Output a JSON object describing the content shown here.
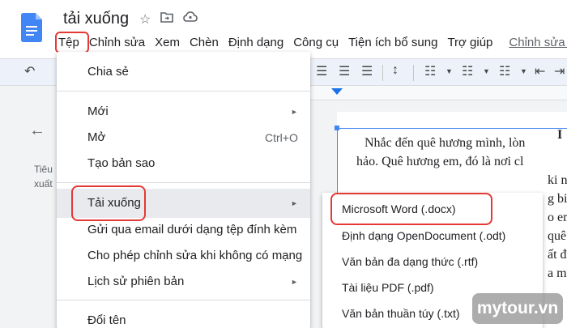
{
  "header": {
    "doc_title": "tải xuống",
    "icons": [
      "star-icon",
      "move-to-folder-icon",
      "cloud-status-icon"
    ]
  },
  "menubar": {
    "items": [
      "Tệp",
      "Chỉnh sửa",
      "Xem",
      "Chèn",
      "Định dạng",
      "Công cụ",
      "Tiện ích bổ sung",
      "Trợ giúp"
    ],
    "edit_link": "Chỉnh sửa lầ"
  },
  "file_menu": {
    "share": "Chia sẻ",
    "new": "Mới",
    "open": "Mở",
    "open_shortcut": "Ctrl+O",
    "make_copy": "Tạo bản sao",
    "download": "Tải xuống",
    "email_attachment": "Gửi qua email dưới dạng tệp đính kèm",
    "offline": "Cho phép chỉnh sửa khi không có mạng",
    "version_history": "Lịch sử phiên bản",
    "rename": "Đổi tên"
  },
  "download_submenu": {
    "items": [
      "Microsoft Word (.docx)",
      "Định dạng OpenDocument (.odt)",
      "Văn bản đa dạng thức (.rtf)",
      "Tài liệu PDF (.pdf)",
      "Văn bản thuần túy (.txt)"
    ]
  },
  "outline": {
    "line1": "Tiêu",
    "line2": "xuất"
  },
  "document": {
    "heading_fragment": "I",
    "lines": [
      "Nhắc đến quê hương mình, lòn",
      "hảo. Quê hương em, đó là nơi cl",
      "ki niệm",
      "g biế",
      "o em n",
      "quê",
      "ất đẹ",
      "a mù"
    ]
  },
  "watermark": "mytour.vn",
  "colors": {
    "highlight_box": "#e53935",
    "doc_blue": "#4285f4"
  }
}
